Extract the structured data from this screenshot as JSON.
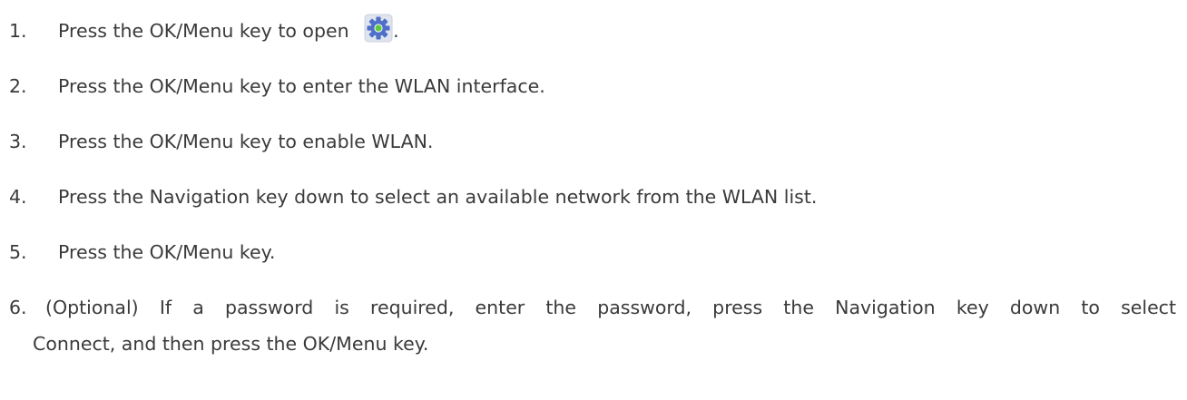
{
  "steps": [
    {
      "number": "1.",
      "text": "Press the OK/Menu key to open ",
      "icon": "settings-gear-icon",
      "suffix": "."
    },
    {
      "number": "2.",
      "text": "Press the OK/Menu key to enter the WLAN interface."
    },
    {
      "number": "3.",
      "text": "Press the OK/Menu key to enable WLAN."
    },
    {
      "number": "4.",
      "text": "Press the Navigation key down to select an available network from the WLAN list."
    },
    {
      "number": "5.",
      "text": "Press the OK/Menu key."
    },
    {
      "number": "6.",
      "text": "(Optional) If a password is required, enter the password, press the Navigation key down to select",
      "text_continued": "Connect, and then press the OK/Menu key."
    }
  ],
  "colors": {
    "text": "#3a3a3a",
    "icon_tile": "#dfe4ee",
    "gear": "#4f6fc9",
    "gear_center": "#5cc83c"
  }
}
